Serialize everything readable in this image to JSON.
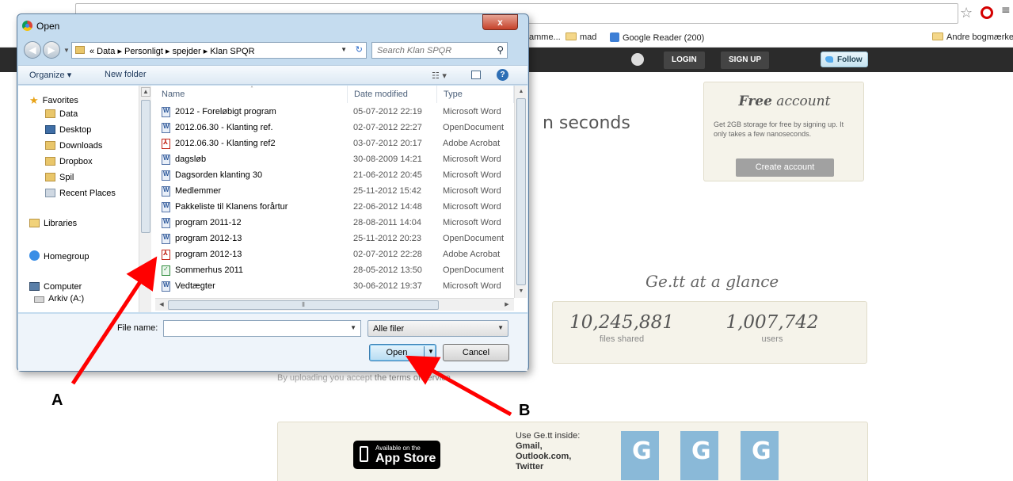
{
  "browser": {
    "bookmarks": [
      {
        "label": "amme...",
        "icon": "folder-icon"
      },
      {
        "label": "mad",
        "icon": "folder-icon"
      },
      {
        "label": "Google Reader (200)",
        "icon": "google-reader-icon"
      }
    ],
    "other_bookmarks": "Andre bogmærker"
  },
  "site_header": {
    "login": "LOGIN",
    "signup": "SIGN UP",
    "follow": "Follow"
  },
  "page": {
    "hero_text": "n seconds",
    "free_account": {
      "title_bold": "Free",
      "title_rest": " account",
      "description": "Get 2GB storage for free by signing up. It only takes a few nanoseconds.",
      "button": "Create account"
    },
    "glance": {
      "title": "Ge.tt at a glance",
      "stats": [
        {
          "value": "10,245,881",
          "label": "files shared"
        },
        {
          "value": "1,007,742",
          "label": "users"
        }
      ]
    },
    "terms": {
      "prefix": "By uploading you accept ",
      "link": "the terms of service."
    },
    "apps": {
      "appstore_small": "Available on the",
      "appstore_big": "App Store",
      "inside_label": "Use Ge.tt inside:",
      "services": [
        "Gmail,",
        "Outlook.com,",
        "Twitter"
      ]
    }
  },
  "dialog": {
    "title": "Open",
    "close": "x",
    "breadcrumb": "« Data ▸ Personligt ▸ spejder ▸ Klan SPQR",
    "search_placeholder": "Search Klan SPQR",
    "toolbar": {
      "organize": "Organize ▾",
      "new_folder": "New folder"
    },
    "nav": [
      {
        "label": "Favorites",
        "icon": "favorites-star-icon"
      },
      {
        "label": "Data",
        "icon": "folder-icon"
      },
      {
        "label": "Desktop",
        "icon": "desktop-icon"
      },
      {
        "label": "Downloads",
        "icon": "downloads-icon"
      },
      {
        "label": "Dropbox",
        "icon": "dropbox-icon"
      },
      {
        "label": "Spil",
        "icon": "folder-icon"
      },
      {
        "label": "Recent Places",
        "icon": "recent-places-icon"
      },
      {
        "label": "Libraries",
        "icon": "libraries-icon"
      },
      {
        "label": "Homegroup",
        "icon": "homegroup-icon"
      },
      {
        "label": "Computer",
        "icon": "computer-icon"
      },
      {
        "label": "Arkiv (A:)",
        "icon": "drive-icon"
      }
    ],
    "columns": [
      "Name",
      "Date modified",
      "Type"
    ],
    "files": [
      {
        "name": "2012 - Foreløbigt program",
        "date": "05-07-2012 22:19",
        "type": "Microsoft Word",
        "kind": "word"
      },
      {
        "name": "2012.06.30 - Klanting ref.",
        "date": "02-07-2012 22:27",
        "type": "OpenDocument",
        "kind": "word"
      },
      {
        "name": "2012.06.30 - Klanting ref2",
        "date": "03-07-2012 20:17",
        "type": "Adobe Acrobat",
        "kind": "pdf"
      },
      {
        "name": "dagsløb",
        "date": "30-08-2009 14:21",
        "type": "Microsoft Word",
        "kind": "word"
      },
      {
        "name": "Dagsorden klanting 30",
        "date": "21-06-2012 20:45",
        "type": "Microsoft Word",
        "kind": "word"
      },
      {
        "name": "Medlemmer",
        "date": "25-11-2012 15:42",
        "type": "Microsoft Word",
        "kind": "word"
      },
      {
        "name": "Pakkeliste til Klanens forårtur",
        "date": "22-06-2012 14:48",
        "type": "Microsoft Word",
        "kind": "word"
      },
      {
        "name": "program 2011-12",
        "date": "28-08-2011 14:04",
        "type": "Microsoft Word",
        "kind": "word"
      },
      {
        "name": "program 2012-13",
        "date": "25-11-2012 20:23",
        "type": "OpenDocument",
        "kind": "word"
      },
      {
        "name": "program 2012-13",
        "date": "02-07-2012 22:28",
        "type": "Adobe Acrobat",
        "kind": "pdf"
      },
      {
        "name": "Sommerhus 2011",
        "date": "28-05-2012 13:50",
        "type": "OpenDocument",
        "kind": "odt"
      },
      {
        "name": "Vedtægter",
        "date": "30-06-2012 19:37",
        "type": "Microsoft Word",
        "kind": "word"
      }
    ],
    "file_name_label": "File name:",
    "file_name_value": "",
    "filter": "Alle filer",
    "open": "Open",
    "cancel": "Cancel"
  },
  "annotations": [
    {
      "label": "A",
      "color": "#ff0000"
    },
    {
      "label": "B",
      "color": "#ff0000"
    }
  ]
}
